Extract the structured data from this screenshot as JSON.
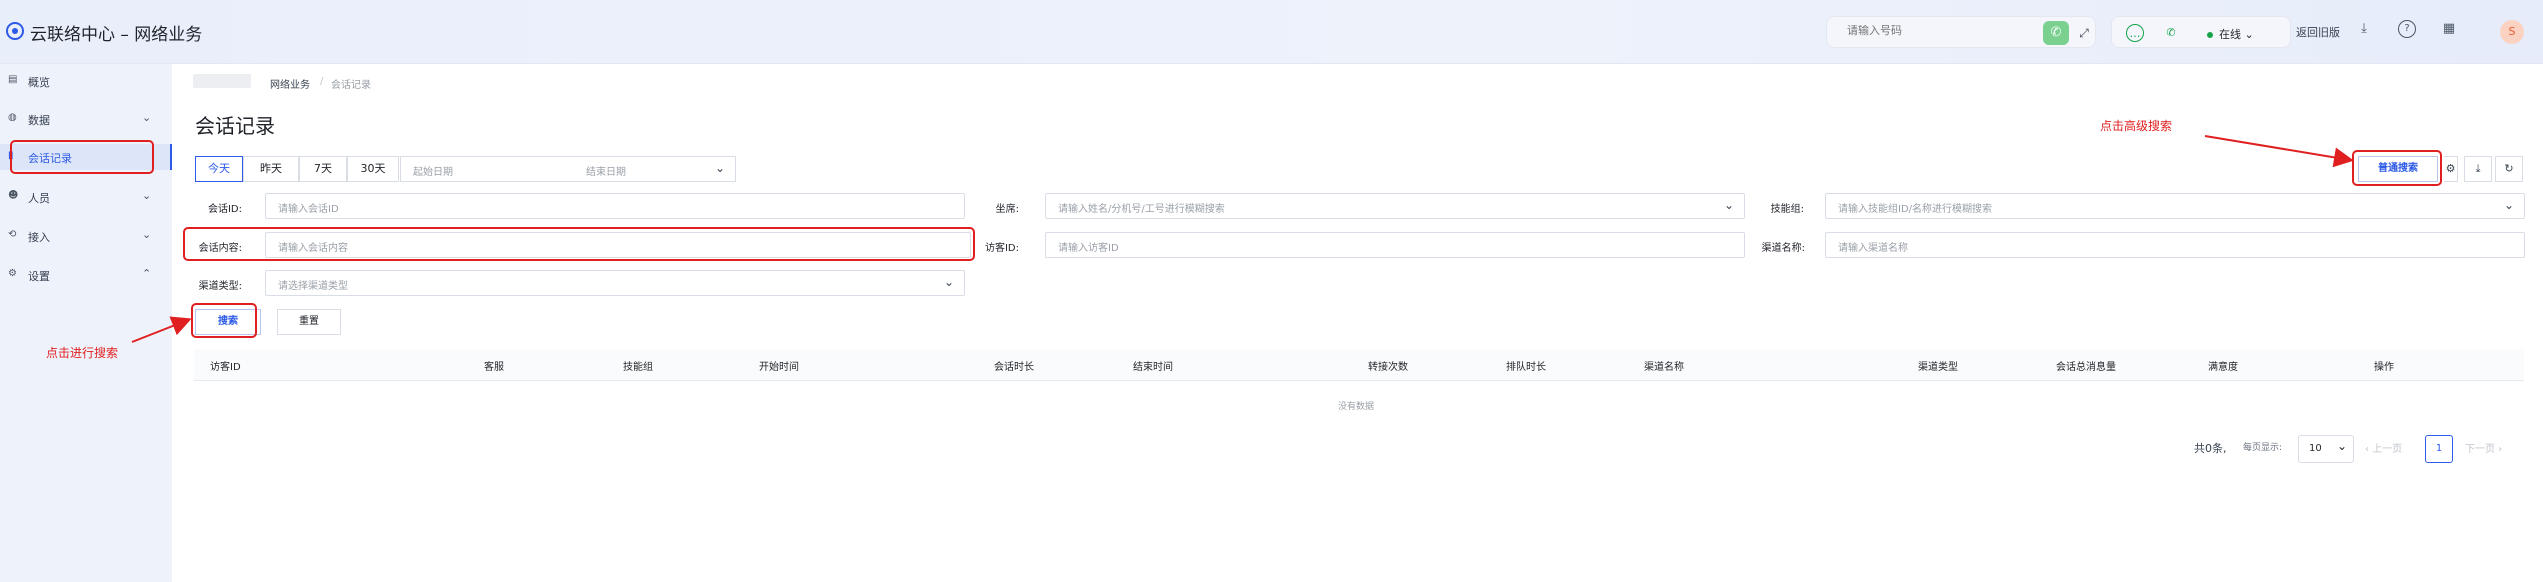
{
  "header": {
    "app_title": "云联络中心 – 网络业务",
    "phone_placeholder": "请输入号码",
    "status": "在线",
    "back_old": "返回旧版",
    "avatar_text": "S"
  },
  "sidebar": {
    "items": [
      {
        "label": "概览",
        "icon": "dashboard-icon"
      },
      {
        "label": "数据",
        "icon": "data-icon",
        "chevron": "⌄"
      },
      {
        "label": "会话记录",
        "icon": "session-icon",
        "active": true
      },
      {
        "label": "人员",
        "icon": "users-icon",
        "chevron": "⌄"
      },
      {
        "label": "接入",
        "icon": "access-icon",
        "chevron": "⌄"
      },
      {
        "label": "设置",
        "icon": "settings-icon",
        "chevron": "⌃"
      }
    ]
  },
  "breadcrumb": {
    "parent": "网络业务",
    "sep": "/",
    "current": "会话记录"
  },
  "page_title": "会话记录",
  "date_tabs": [
    "今天",
    "昨天",
    "7天",
    "30天"
  ],
  "daterange": {
    "start_placeholder": "起始日期",
    "end_placeholder": "结束日期"
  },
  "filters": {
    "session_id": {
      "label": "会话ID:",
      "placeholder": "请输入会话ID"
    },
    "agent": {
      "label": "坐席:",
      "placeholder": "请输入姓名/分机号/工号进行模糊搜索"
    },
    "skill_group": {
      "label": "技能组:",
      "placeholder": "请输入技能组ID/名称进行模糊搜索"
    },
    "content": {
      "label": "会话内容:",
      "placeholder": "请输入会话内容"
    },
    "visitor_id": {
      "label": "访客ID:",
      "placeholder": "请输入访客ID"
    },
    "channel_name": {
      "label": "渠道名称:",
      "placeholder": "请输入渠道名称"
    },
    "channel_type": {
      "label": "渠道类型:",
      "placeholder": "请选择渠道类型"
    }
  },
  "buttons": {
    "search": "搜索",
    "reset": "重置",
    "normal_search": "普通搜索"
  },
  "table": {
    "columns": [
      "访客ID",
      "客服",
      "技能组",
      "开始时间",
      "会话时长",
      "结束时间",
      "转接次数",
      "排队时长",
      "渠道名称",
      "渠道类型",
      "会话总消息量",
      "满意度",
      "操作"
    ],
    "empty_text": "没有数据"
  },
  "pagination": {
    "total": "共0条,",
    "per_page_label": "每页显示:",
    "per_page": "10",
    "prev": "上一页",
    "current": "1",
    "next": "下一页"
  },
  "annotations": {
    "advanced_search": "点击高级搜索",
    "do_search": "点击进行搜索"
  },
  "colors": {
    "accent": "#2d5ae6",
    "annotation": "#e02020",
    "online": "#16a34a"
  }
}
